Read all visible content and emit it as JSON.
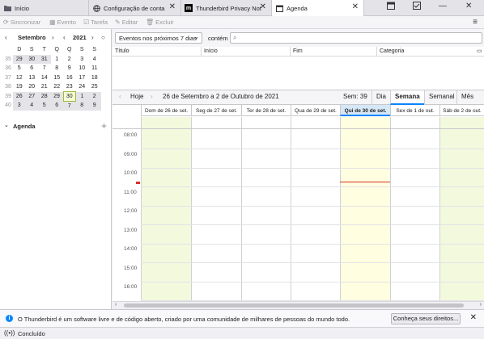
{
  "tabs": [
    {
      "label": "Início",
      "icon": "folder-icon"
    },
    {
      "label": "Configuração de conta",
      "icon": "globe-icon"
    },
    {
      "label": "Thunderbird Privacy Not",
      "icon": "mozilla-icon"
    },
    {
      "label": "Agenda",
      "icon": "calendar-icon",
      "active": true
    }
  ],
  "toolbar": {
    "sync": "Sincronizar",
    "event": "Evento",
    "task": "Tarefa",
    "edit": "Editar",
    "delete": "Excluir"
  },
  "minicalendar": {
    "month": "Setembro",
    "year": "2021",
    "weekday_headers": [
      "D",
      "S",
      "T",
      "Q",
      "Q",
      "S",
      "S"
    ],
    "weeks": [
      {
        "num": "35",
        "days": [
          "29",
          "30",
          "31",
          "1",
          "2",
          "3",
          "4"
        ]
      },
      {
        "num": "36",
        "days": [
          "5",
          "6",
          "7",
          "8",
          "9",
          "10",
          "11"
        ]
      },
      {
        "num": "37",
        "days": [
          "12",
          "13",
          "14",
          "15",
          "16",
          "17",
          "18"
        ]
      },
      {
        "num": "38",
        "days": [
          "19",
          "20",
          "21",
          "22",
          "23",
          "24",
          "25"
        ]
      },
      {
        "num": "39",
        "days": [
          "26",
          "27",
          "28",
          "29",
          "30",
          "1",
          "2"
        ]
      },
      {
        "num": "40",
        "days": [
          "3",
          "4",
          "5",
          "6",
          "7",
          "8",
          "9"
        ]
      }
    ]
  },
  "agenda_section": {
    "label": "Agenda"
  },
  "filter": {
    "selected": "Eventos nos próximos 7 dias",
    "contains_label": "contém",
    "search_value": ""
  },
  "list_columns": [
    "Título",
    "Início",
    "Fim",
    "Categoria"
  ],
  "viewnav": {
    "today": "Hoje",
    "range": "26 de Setembro a 2 de Outubro de 2021",
    "week_number": "Sem: 39",
    "views": [
      "Dia",
      "Semana",
      "Semanal",
      "Mês"
    ],
    "active_view": "Semana"
  },
  "week": {
    "days": [
      {
        "label": "Dom de 26 de set."
      },
      {
        "label": "Seg de 27 de set."
      },
      {
        "label": "Ter de 28 de set."
      },
      {
        "label": "Qua de 29 de set."
      },
      {
        "label": "Qui de 30 de set.",
        "today": true
      },
      {
        "label": "Sex de 1 de out."
      },
      {
        "label": "Sáb de 2 de out."
      }
    ],
    "hours": [
      "08:00",
      "09:00",
      "10:00",
      "11:00",
      "12:00",
      "13:00",
      "14:00",
      "15:00",
      "16:00"
    ]
  },
  "notification": {
    "message": "O Thunderbird é um software livre e de código aberto, criado por uma comunidade de milhares de pessoas do mundo todo.",
    "button": "Conheça seus direitos..."
  },
  "status": {
    "text": "Concluído"
  }
}
